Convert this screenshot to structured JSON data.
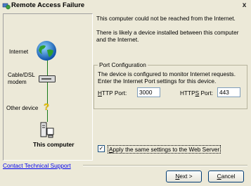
{
  "window": {
    "title": "Remote Access Failure",
    "close_label": "x"
  },
  "diagram": {
    "internet_label": "Internet",
    "modem_label": "Cable/DSL\nmodem",
    "other_device_label": "Other device",
    "computer_label": "This computer"
  },
  "main": {
    "line1": "This computer could not be reached from the Internet.",
    "line2": "There is likely a device installed between this computer and the Internet."
  },
  "port_config": {
    "legend": "Port Configuration",
    "description": "The device is configured to monitor Internet requests. Enter the Internet Port settings for this device.",
    "http_label_pre": "",
    "http_label_u": "H",
    "http_label_post": "TTP Port:",
    "http_value": "3000",
    "https_label_pre": "HTTP",
    "https_label_u": "S",
    "https_label_post": " Port:",
    "https_value": "443"
  },
  "apply_checkbox": {
    "checked": true,
    "label_u": "A",
    "label_post": "pply the same settings to the Web Server"
  },
  "footer": {
    "support_link": "Contact Technical Support",
    "next_u": "N",
    "next_post": "ext >",
    "cancel_u": "C",
    "cancel_post": "ancel"
  },
  "colors": {
    "link": "#0000ee",
    "line": "#1a7a1a",
    "background": "#ece9d8"
  }
}
